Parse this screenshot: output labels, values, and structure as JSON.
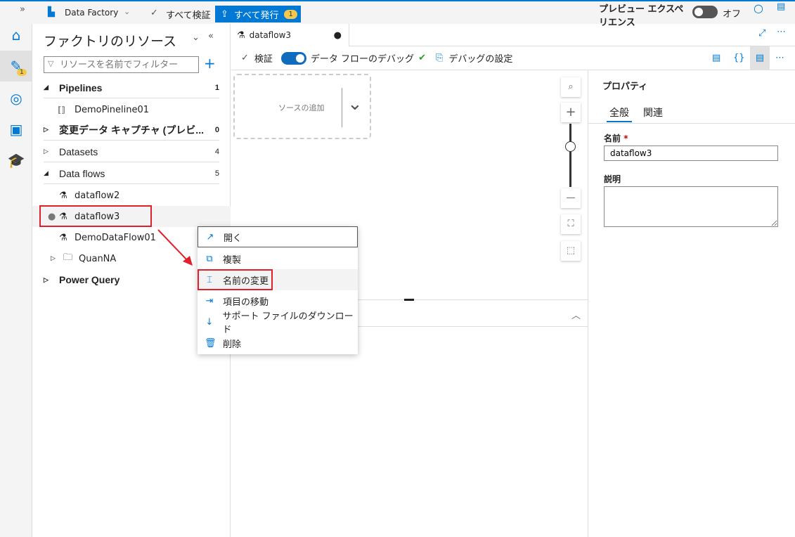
{
  "topbar": {
    "factory": "Data Factory",
    "validate_all": "すべて検証",
    "publish_all": "すべて発行",
    "publish_count": "1",
    "preview_label_1": "プレビュー エクスペ",
    "preview_label_2": "リエンス",
    "preview_state": "オフ"
  },
  "rail": {
    "author_badge": "1"
  },
  "resources": {
    "title": "ファクトリのリソース",
    "filter_placeholder": "リソースを名前でフィルター",
    "pipelines": {
      "label": "Pipelines",
      "count": "1",
      "items": [
        "DemoPineline01"
      ]
    },
    "cdc": {
      "label": "変更データ キャプチャ (プレビ...",
      "count": "0"
    },
    "datasets": {
      "label": "Datasets",
      "count": "4"
    },
    "dataflows": {
      "label": "Data flows",
      "count": "5",
      "items": [
        "dataflow2",
        "dataflow3",
        "DemoDataFlow01"
      ],
      "folder": "QuanNA"
    },
    "powerquery": {
      "label": "Power Query"
    }
  },
  "tab": {
    "name": "dataflow3"
  },
  "toolbar": {
    "validate": "検証",
    "debug": "データ フローのデバッグ",
    "debug_settings": "デバッグの設定"
  },
  "canvas": {
    "add_source": "ソースの追加"
  },
  "context_menu": [
    "開く",
    "複製",
    "名前の変更",
    "項目の移動",
    "サポート ファイルのダウンロード",
    "削除"
  ],
  "properties": {
    "title": "プロパティ",
    "tabs": [
      "全般",
      "関連"
    ],
    "name_label": "名前",
    "name_value": "dataflow3",
    "desc_label": "説明"
  },
  "colors": {
    "accent": "#0078d4",
    "highlight": "#e0202a"
  }
}
